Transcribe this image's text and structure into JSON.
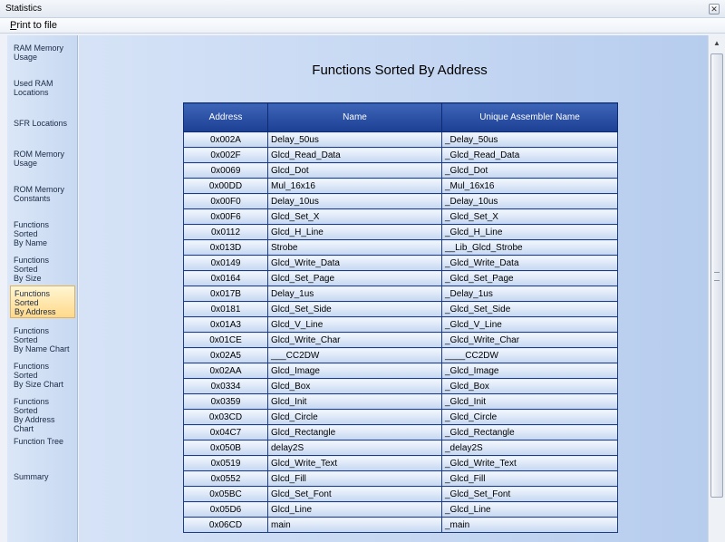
{
  "window": {
    "title": "Statistics",
    "close_icon": "close-icon"
  },
  "menu": {
    "print_ul": "P",
    "print_rest": "rint to file"
  },
  "sidebar": {
    "items": [
      {
        "line1": "RAM Memory",
        "line2": "Usage"
      },
      {
        "line1": "Used RAM",
        "line2": "Locations"
      },
      {
        "line1": "SFR Locations",
        "line2": ""
      },
      {
        "line1": "ROM Memory",
        "line2": "Usage"
      },
      {
        "line1": "ROM Memory",
        "line2": "Constants"
      },
      {
        "line1": "Functions Sorted",
        "line2": "By  Name"
      },
      {
        "line1": "Functions Sorted",
        "line2": "By Size"
      },
      {
        "line1": "Functions Sorted",
        "line2": "By Address"
      },
      {
        "line1": "Functions Sorted",
        "line2": "By Name Chart"
      },
      {
        "line1": "Functions Sorted",
        "line2": "By Size Chart"
      },
      {
        "line1": "Functions Sorted",
        "line2": "By Address Chart"
      },
      {
        "line1": "Function Tree",
        "line2": ""
      },
      {
        "line1": "Summary",
        "line2": ""
      }
    ],
    "active_index": 7
  },
  "main": {
    "title": "Functions Sorted By Address",
    "headers": [
      "Address",
      "Name",
      "Unique Assembler Name"
    ],
    "rows": [
      [
        "0x002A",
        "Delay_50us",
        "_Delay_50us"
      ],
      [
        "0x002F",
        "Glcd_Read_Data",
        "_Glcd_Read_Data"
      ],
      [
        "0x0069",
        "Glcd_Dot",
        "_Glcd_Dot"
      ],
      [
        "0x00DD",
        "Mul_16x16",
        "_Mul_16x16"
      ],
      [
        "0x00F0",
        "Delay_10us",
        "_Delay_10us"
      ],
      [
        "0x00F6",
        "Glcd_Set_X",
        "_Glcd_Set_X"
      ],
      [
        "0x0112",
        "Glcd_H_Line",
        "_Glcd_H_Line"
      ],
      [
        "0x013D",
        "Strobe",
        "__Lib_Glcd_Strobe"
      ],
      [
        "0x0149",
        "Glcd_Write_Data",
        "_Glcd_Write_Data"
      ],
      [
        "0x0164",
        "Glcd_Set_Page",
        "_Glcd_Set_Page"
      ],
      [
        "0x017B",
        "Delay_1us",
        "_Delay_1us"
      ],
      [
        "0x0181",
        "Glcd_Set_Side",
        "_Glcd_Set_Side"
      ],
      [
        "0x01A3",
        "Glcd_V_Line",
        "_Glcd_V_Line"
      ],
      [
        "0x01CE",
        "Glcd_Write_Char",
        "_Glcd_Write_Char"
      ],
      [
        "0x02A5",
        "___CC2DW",
        "____CC2DW"
      ],
      [
        "0x02AA",
        "Glcd_Image",
        "_Glcd_Image"
      ],
      [
        "0x0334",
        "Glcd_Box",
        "_Glcd_Box"
      ],
      [
        "0x0359",
        "Glcd_Init",
        "_Glcd_Init"
      ],
      [
        "0x03CD",
        "Glcd_Circle",
        "_Glcd_Circle"
      ],
      [
        "0x04C7",
        "Glcd_Rectangle",
        "_Glcd_Rectangle"
      ],
      [
        "0x050B",
        "delay2S",
        "_delay2S"
      ],
      [
        "0x0519",
        "Glcd_Write_Text",
        "_Glcd_Write_Text"
      ],
      [
        "0x0552",
        "Glcd_Fill",
        "_Glcd_Fill"
      ],
      [
        "0x05BC",
        "Glcd_Set_Font",
        "_Glcd_Set_Font"
      ],
      [
        "0x05D6",
        "Glcd_Line",
        "_Glcd_Line"
      ],
      [
        "0x06CD",
        "main",
        "_main"
      ]
    ]
  }
}
